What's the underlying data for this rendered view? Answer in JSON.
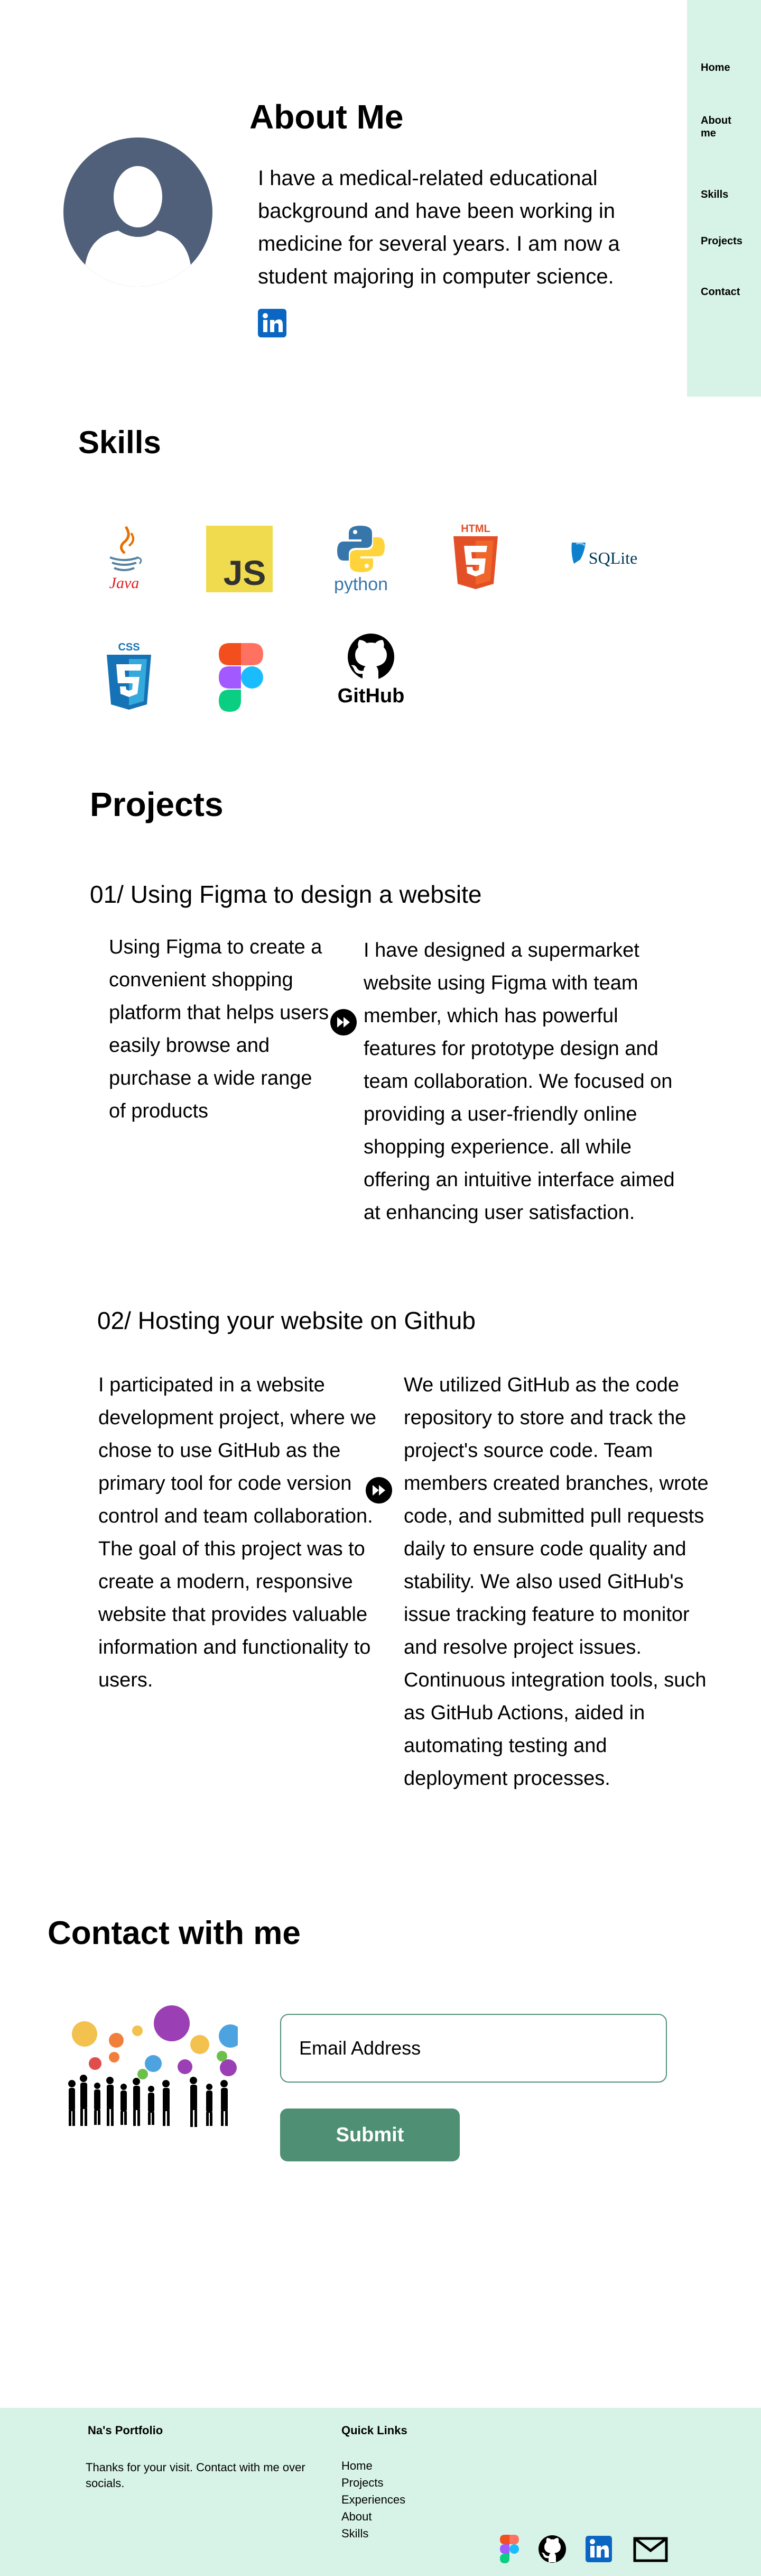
{
  "nav": {
    "items": [
      {
        "label": "Home"
      },
      {
        "label": "About me"
      },
      {
        "label": "Skills"
      },
      {
        "label": "Projects"
      },
      {
        "label": "Contact"
      }
    ]
  },
  "about": {
    "title": "About Me",
    "text": "I have a medical-related educational background and have been working in medicine for several years. I am now a student majoring in computer science.",
    "avatar_icon": "user-avatar-icon",
    "social_icon": "linkedin-icon"
  },
  "skills": {
    "title": "Skills",
    "items": [
      {
        "name": "Java",
        "icon": "java-logo"
      },
      {
        "name": "JS",
        "icon": "javascript-logo"
      },
      {
        "name": "python",
        "icon": "python-logo"
      },
      {
        "name": "HTML",
        "icon": "html5-logo"
      },
      {
        "name": "SQLite",
        "icon": "sqlite-logo"
      },
      {
        "name": "CSS",
        "icon": "css3-logo"
      },
      {
        "name": "Figma",
        "icon": "figma-logo"
      },
      {
        "name": "GitHub",
        "icon": "github-logo"
      }
    ]
  },
  "projects": {
    "title": "Projects",
    "items": [
      {
        "title": "01/ Using Figma to design a website",
        "summary": "Using Figma to create a convenient shopping platform that helps users easily browse and purchase a wide range of products",
        "detail": "I have designed a supermarket website using Figma with team member, which has powerful features for prototype design and team collaboration. We focused on providing a user-friendly online shopping experience. all while offering an intuitive interface aimed at enhancing user satisfaction."
      },
      {
        "title": "02/ Hosting your website on Github",
        "summary": " I participated in a website development project, where we chose to use GitHub as the primary tool for code version control and team collaboration. The goal of this project was to create a modern, responsive website that provides valuable information and functionality to users.",
        "detail": "We utilized GitHub as the code repository to store and track the project's source code. Team members created branches, wrote code, and submitted pull requests daily to ensure code quality and stability. We also used GitHub's issue tracking feature to monitor and resolve project issues. Continuous integration tools, such as GitHub Actions, aided in automating testing and deployment processes."
      }
    ]
  },
  "contact": {
    "title": "Contact with me",
    "email_placeholder": "Email Address",
    "submit_label": "Submit"
  },
  "footer": {
    "brand": "Na's Portfolio",
    "message": "Thanks for  your visit. Contact with me over socials.",
    "quick_links_title": "Quick Links",
    "links": [
      "Home",
      "Projects",
      "Experiences",
      "About",
      "Skills"
    ],
    "social_icons": [
      "figma-icon",
      "github-icon",
      "linkedin-icon",
      "mail-icon"
    ]
  },
  "colors": {
    "accent": "#4f8f74",
    "panel_bg": "#d7f3e7",
    "avatar_bg": "#50607a"
  }
}
